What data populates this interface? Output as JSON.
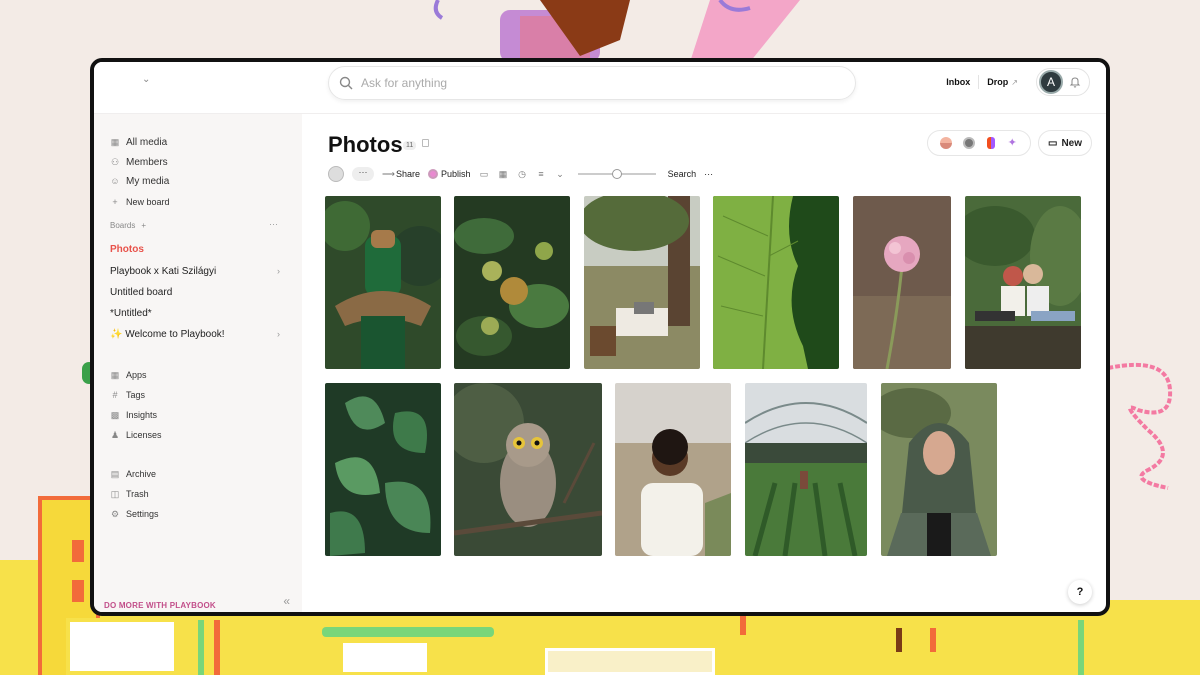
{
  "search": {
    "placeholder": "Ask for anything"
  },
  "topbar": {
    "inbox_label": "Inbox",
    "drop_label": "Drop",
    "avatar_initial": "A"
  },
  "sidebar": {
    "items": [
      {
        "label": "All media",
        "icon": "grid-icon"
      },
      {
        "label": "Members",
        "icon": "person-icon"
      },
      {
        "label": "My media",
        "icon": "smiley-icon"
      },
      {
        "label": "New board",
        "icon": "plus-icon"
      }
    ],
    "boards_header": "Boards",
    "boards": [
      {
        "label": "Photos",
        "active": true,
        "has_children": false
      },
      {
        "label": "Playbook x Kati Szilágyi",
        "active": false,
        "has_children": true
      },
      {
        "label": "Untitled board",
        "active": false,
        "has_children": false
      },
      {
        "label": "*Untitled*",
        "active": false,
        "has_children": false
      },
      {
        "label": "✨ Welcome to Playbook!",
        "active": false,
        "has_children": true
      }
    ],
    "tools": [
      {
        "label": "Apps",
        "icon": "apps-icon"
      },
      {
        "label": "Tags",
        "icon": "hash-icon"
      },
      {
        "label": "Insights",
        "icon": "chart-icon"
      },
      {
        "label": "Licenses",
        "icon": "license-icon"
      }
    ],
    "system": [
      {
        "label": "Archive",
        "icon": "archive-icon"
      },
      {
        "label": "Trash",
        "icon": "trash-icon"
      },
      {
        "label": "Settings",
        "icon": "gear-icon"
      }
    ],
    "footer_label": "DO MORE WITH PLAYBOOK"
  },
  "main": {
    "title": "Photos",
    "count": "11",
    "new_label": "New",
    "toolbar": {
      "share_label": "Share",
      "publish_label": "Publish",
      "search_label": "Search",
      "more_label": "···"
    },
    "zoom_level": 0.5,
    "photos": [
      {
        "name": "photo-woman-green-braids"
      },
      {
        "name": "photo-tomato-plant"
      },
      {
        "name": "photo-typewriter-field"
      },
      {
        "name": "photo-leaf-shadow"
      },
      {
        "name": "photo-pink-flower"
      },
      {
        "name": "photo-two-women-log"
      },
      {
        "name": "photo-leafy-plants"
      },
      {
        "name": "photo-owl-branch"
      },
      {
        "name": "photo-smiling-man"
      },
      {
        "name": "photo-greenhouse"
      },
      {
        "name": "photo-woman-headscarf"
      }
    ]
  },
  "colors": {
    "accent": "#e8524a",
    "footer": "#c24f8a",
    "avatar": "#2f3b3f"
  }
}
